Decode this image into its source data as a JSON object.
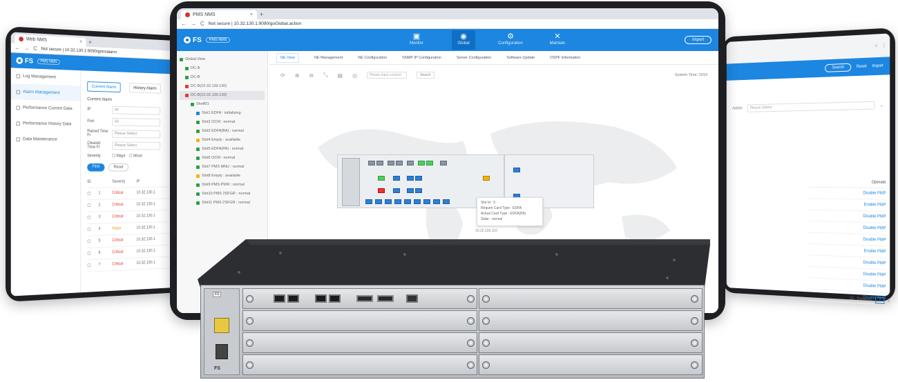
{
  "left_screen": {
    "tab_title": "Web NMS",
    "url": "Not secure | 10.32.130.1:9090/gnm/alarm",
    "app_logo": "FS",
    "app_badge": "PMS NMS",
    "sidebar": [
      {
        "label": "Log Management"
      },
      {
        "label": "Alarm Management"
      },
      {
        "label": "Performance Current Data"
      },
      {
        "label": "Performance History Data"
      },
      {
        "label": "Data Maintenance"
      }
    ],
    "tabs": [
      "Current Alarm",
      "History Alarm"
    ],
    "form_title": "Current Alarm",
    "form_rows": [
      {
        "label": "IP",
        "value": "All"
      },
      {
        "label": "Port",
        "value": "All"
      },
      {
        "label": "Raised Time Fr",
        "value": "Please Select"
      },
      {
        "label": "Cleared Time Fr",
        "value": "Please Select"
      }
    ],
    "severity_label": "Severity",
    "severity_options": [
      "Major",
      "Minor"
    ],
    "btn_primary": "Find",
    "btn_secondary": "Reset",
    "table_header": [
      "ID",
      "Severity",
      "IP"
    ],
    "table_rows": [
      {
        "id": "1",
        "sev": "Critical",
        "ip": "10.32.130.1"
      },
      {
        "id": "2",
        "sev": "Critical",
        "ip": "10.32.130.1"
      },
      {
        "id": "3",
        "sev": "Critical",
        "ip": "10.32.130.1"
      },
      {
        "id": "4",
        "sev": "Major",
        "ip": "10.32.130.1"
      },
      {
        "id": "5",
        "sev": "Critical",
        "ip": "10.32.130.1"
      },
      {
        "id": "6",
        "sev": "Critical",
        "ip": "10.32.130.1"
      },
      {
        "id": "7",
        "sev": "Critical",
        "ip": "10.32.130.1"
      }
    ]
  },
  "center_screen": {
    "tab_title": "PMS NMS",
    "url": "Not secure | 10.32.130.1:9090/goGlobal.action",
    "app_logo": "FS",
    "app_badge": "PMS NMS",
    "nav": [
      {
        "label": "Monitor",
        "glyph": "▣"
      },
      {
        "label": "Global",
        "glyph": "◉"
      },
      {
        "label": "Configuration",
        "glyph": "⚙"
      },
      {
        "label": "Maintain",
        "glyph": "✕"
      }
    ],
    "right_btn": "Import",
    "tree": [
      {
        "label": "Global View"
      },
      {
        "label": "DC-A"
      },
      {
        "label": "DC-B"
      },
      {
        "label": "DC-B(10.32.130.130)"
      },
      {
        "label": "DC-B(10.32.130.130)"
      },
      {
        "label": "Shelf01"
      },
      {
        "label": "Slot1 EDFA : initializing"
      },
      {
        "label": "Slot2 OCM : normal"
      },
      {
        "label": "Slot3 EDFA(BA) : normal"
      },
      {
        "label": "Slot4 Empty : available"
      },
      {
        "label": "Slot5 EDFA(PA) : normal"
      },
      {
        "label": "Slot6 OCM : normal"
      },
      {
        "label": "Slot7 PMS MNU : normal"
      },
      {
        "label": "Slot8 Empty : available"
      },
      {
        "label": "Slot9 PMS PWR : normal"
      },
      {
        "label": "Slot10 PMS 2SFGR : normal"
      },
      {
        "label": "Slot11 PMS 2SFGR : normal"
      }
    ],
    "tabs": [
      "NE View",
      "NE Management",
      "NE Configuration",
      "SNMP IP Configuration",
      "Server Configuration",
      "Software Update",
      "OSPF Information"
    ],
    "search_placeholder": "Please input content",
    "search_btn": "Search",
    "system_time": "System Time: 2019",
    "tooltip": {
      "slot": "Slot Id : 5",
      "req": "Require Card Type : EDFA",
      "actual": "Actual Card Type : EDFA(PA)",
      "state": "State : normal"
    },
    "device_ip": "10.32.130.110"
  },
  "right_screen": {
    "btn_pill": "Search",
    "btn_links": [
      "Reset",
      "Import"
    ],
    "filter_label": "Action",
    "filter_placeholder": "Please Select",
    "list_header": "Operate",
    "list_items": [
      "Disable PMP",
      "Enable PMP",
      "Disable PMP",
      "Disable PMP",
      "Disable PMP",
      "Enable PMP",
      "Disable PMP",
      "Disable PMP",
      "Disable PMP",
      "Disable PMP"
    ],
    "pager": {
      "per": "10",
      "prev": "Previous",
      "current": "1",
      "next": "2"
    }
  },
  "hardware": {
    "brand": "FS",
    "colors": {
      "chassis_top": "#2a2b2e",
      "front": "#c7cacd"
    }
  }
}
